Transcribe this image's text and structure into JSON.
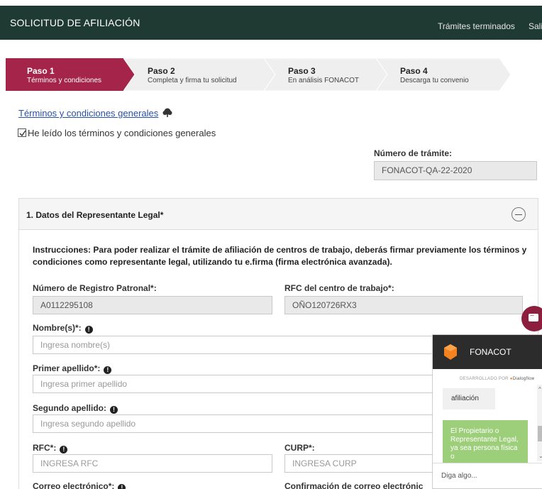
{
  "header": {
    "title": "SOLICITUD DE AFILIACIÓN",
    "nav_finished": "Trámites terminados",
    "nav_exit": "Sali"
  },
  "steps": [
    {
      "num": "Paso 1",
      "sub": "Términos y condiciones",
      "active": true
    },
    {
      "num": "Paso 2",
      "sub": "Completa y firma tu solicitud",
      "active": false
    },
    {
      "num": "Paso 3",
      "sub": "En análisis FONACOT",
      "active": false
    },
    {
      "num": "Paso 4",
      "sub": "Descarga tu convenio",
      "active": false
    }
  ],
  "terms": {
    "link": "Términos y condiciones generales",
    "checkbox_label": "He leído los términos y condiciones generales",
    "checked": true
  },
  "tramite": {
    "label": "Número de trámite:",
    "value": "FONACOT-QA-22-2020"
  },
  "section": {
    "title": "1. Datos del Representante Legal*",
    "instructions": "Instrucciones: Para poder realizar el trámite de afiliación de centros de trabajo, deberás firmar previamente los términos y condiciones como representante legal, utilizando tu e.firma (firma electrónica avanzada).",
    "registro_label": "Número de Registro Patronal*:",
    "registro_value": "A0112295108",
    "rfc_centro_label": "RFC del centro de trabajo*:",
    "rfc_centro_value": "OÑO120726RX3",
    "nombre_label": "Nombre(s)*:",
    "nombre_placeholder": "Ingresa nombre(s)",
    "primer_label": "Primer apellido*:",
    "primer_placeholder": "Ingresa primer apellido",
    "segundo_label": "Segundo apellido:",
    "segundo_placeholder": "Ingresa segundo apellido",
    "rfc_label": "RFC*:",
    "rfc_placeholder": "INGRESA RFC",
    "curp_label": "CURP*:",
    "curp_placeholder": "INGRESA CURP",
    "correo_label": "Correo electrónico*:",
    "confirm_label": "Confirmación de correo electrónic"
  },
  "chat": {
    "name": "FONACOT",
    "powered_prefix": "DESARROLLADO POR",
    "powered_brand": "Dialogflow",
    "msg1": "afiliación",
    "msg2": "El Propietario o Representante Legal, ya sea persona física o",
    "input_placeholder": "Diga algo..."
  },
  "colors": {
    "header_bg": "#1f3a33",
    "active_step": "#a4244a",
    "inactive_step": "#efefef",
    "chat_bubble": "#8b1f3d",
    "bot_msg": "#9dcf7b"
  }
}
